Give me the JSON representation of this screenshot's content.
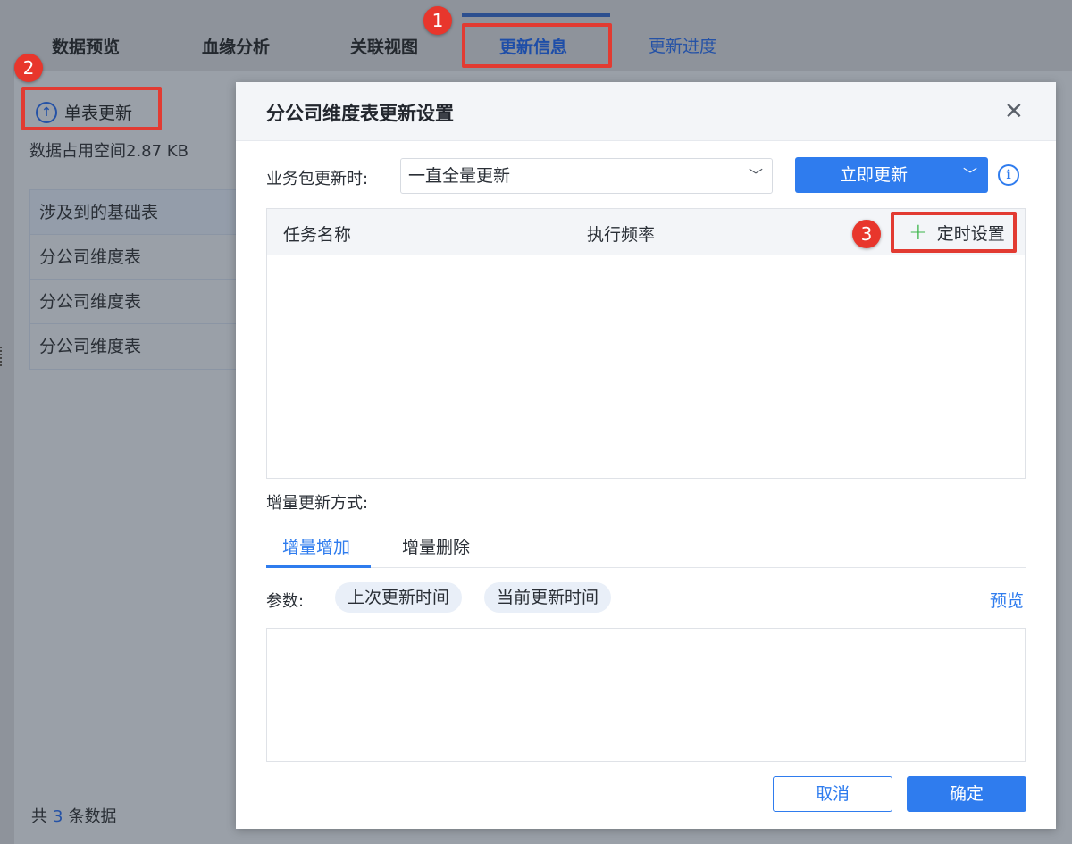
{
  "tabs": [
    {
      "label": "数据预览"
    },
    {
      "label": "血缘分析"
    },
    {
      "label": "关联视图"
    },
    {
      "label": "更新信息"
    },
    {
      "label": "更新进度"
    }
  ],
  "left_panel": {
    "single_update_label": "单表更新",
    "storage_text": "数据占用空间2.87 KB",
    "base_table_header": "涉及到的基础表",
    "base_table_rows": [
      "分公司维度表",
      "分公司维度表",
      "分公司维度表"
    ],
    "total_prefix": "共",
    "total_count": "3",
    "total_suffix": "条数据"
  },
  "callouts": [
    "1",
    "2",
    "3"
  ],
  "dialog": {
    "title": "分公司维度表更新设置",
    "close_icon": "close-icon",
    "update_mode_label": "业务包更新时:",
    "update_mode_value": "一直全量更新",
    "update_now_label": "立即更新",
    "task_table": {
      "col_name": "任务名称",
      "col_frequency": "执行频率",
      "schedule_label": "定时设置"
    },
    "incremental_label": "增量更新方式:",
    "incremental_tabs": [
      "增量增加",
      "增量删除"
    ],
    "param_label": "参数:",
    "param_chips": [
      "上次更新时间",
      "当前更新时间"
    ],
    "preview_label": "预览",
    "cancel_label": "取消",
    "ok_label": "确定"
  },
  "colors": {
    "accent": "#2f7cee",
    "callout": "#e23b32",
    "add_icon": "#3bb54a"
  }
}
